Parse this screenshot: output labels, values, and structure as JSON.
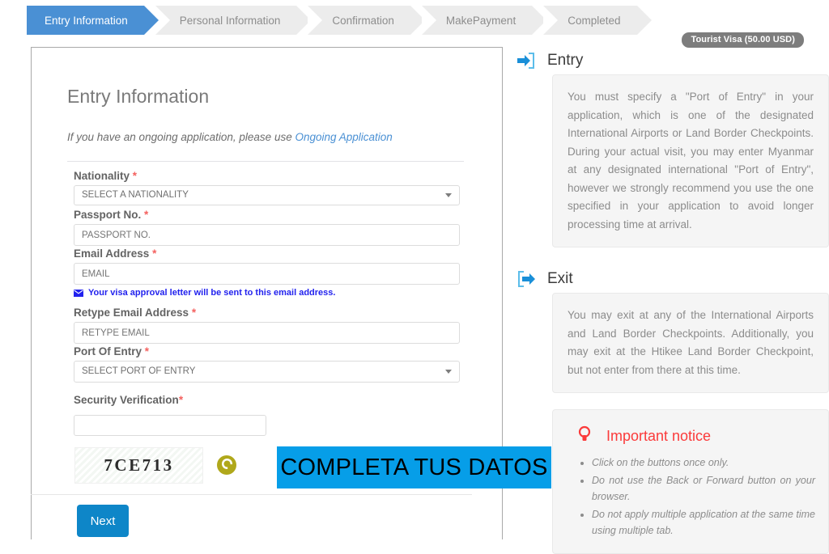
{
  "wizard": {
    "steps": [
      {
        "label": "Entry Information",
        "active": true
      },
      {
        "label": "Personal Information",
        "active": false
      },
      {
        "label": "Confirmation",
        "active": false
      },
      {
        "label": "MakePayment",
        "active": false
      },
      {
        "label": "Completed",
        "active": false
      }
    ]
  },
  "form": {
    "badge": "Tourist Visa (50.00 USD)",
    "title": "Entry Information",
    "ongoing_prefix": "If you have an ongoing application, please use ",
    "ongoing_link": "Ongoing Application",
    "fields": {
      "nationality": {
        "label": "Nationality",
        "required": "*",
        "value": "SELECT A NATIONALITY",
        "type": "select"
      },
      "passport": {
        "label": "Passport No.",
        "required": "*",
        "placeholder": "PASSPORT NO.",
        "value": "",
        "type": "text"
      },
      "email": {
        "label": "Email Address",
        "required": "*",
        "placeholder": "EMAIL",
        "value": "",
        "type": "text"
      },
      "email_note": "Your visa approval letter will be sent to this email address.",
      "retype_email": {
        "label": "Retype Email Address",
        "required": "*",
        "placeholder": "RETYPE EMAIL",
        "value": "",
        "type": "text"
      },
      "port_of_entry": {
        "label": "Port Of Entry",
        "required": "*",
        "value": "SELECT PORT OF ENTRY",
        "type": "select"
      },
      "security_verification": {
        "label": "Security Verification",
        "required": "*",
        "placeholder": "",
        "value": "",
        "type": "text"
      }
    },
    "captcha_text": "7CE713",
    "next_label": "Next"
  },
  "annotation": {
    "text": "COMPLETA TUS DATOS",
    "bg": "#069ee8",
    "color": "#000000"
  },
  "sidebar": {
    "entry": {
      "icon": "sign-in-icon",
      "title": "Entry",
      "body": "You must specify a \"Port of Entry\" in your application, which is one of the designated International Airports or Land Border Checkpoints. During your actual visit, you may enter Myanmar at any designated international \"Port of Entry\", however we strongly recommend you use the one specified in your application to avoid longer processing time at arrival."
    },
    "exit": {
      "icon": "sign-out-icon",
      "title": "Exit",
      "body": "You may exit at any of the International Airports and Land Border Checkpoints. Additionally, you may exit at the Htikee Land Border Checkpoint, but not enter from there at this time."
    },
    "notice": {
      "icon": "lightbulb-icon",
      "title": "Important notice",
      "items": [
        "Click on the buttons once only.",
        "Do not use the Back or Forward button on your browser.",
        "Do not apply multiple application at the same time using multiple tab."
      ]
    }
  },
  "colors": {
    "accent_blue": "#4a90d4",
    "button_blue": "#0e86c8",
    "required_red": "#f4615f",
    "notice_red": "#fb3a3a",
    "note_blue": "#2222ee",
    "captcha_refresh": "#b0a81b"
  }
}
